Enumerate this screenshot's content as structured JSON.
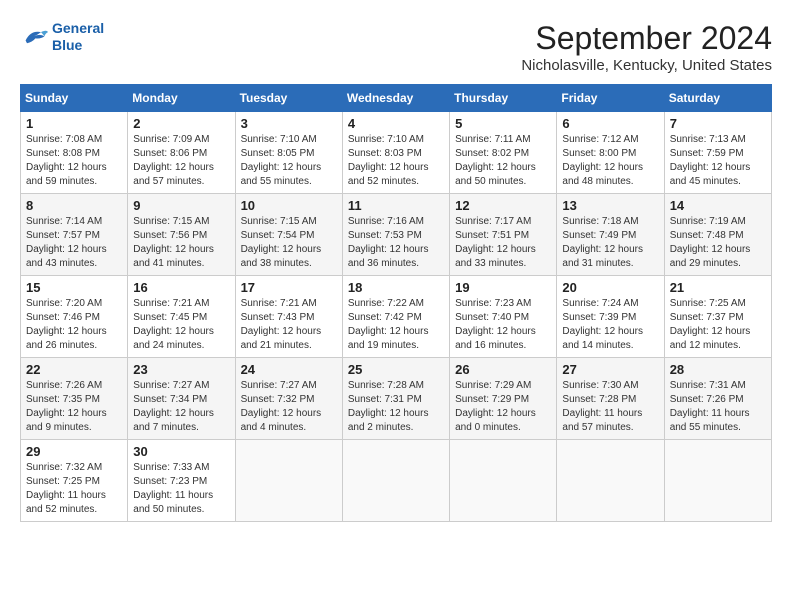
{
  "header": {
    "logo_line1": "General",
    "logo_line2": "Blue",
    "month_year": "September 2024",
    "location": "Nicholasville, Kentucky, United States"
  },
  "calendar": {
    "weekdays": [
      "Sunday",
      "Monday",
      "Tuesday",
      "Wednesday",
      "Thursday",
      "Friday",
      "Saturday"
    ],
    "weeks": [
      [
        {
          "day": "",
          "info": ""
        },
        {
          "day": "2",
          "info": "Sunrise: 7:09 AM\nSunset: 8:06 PM\nDaylight: 12 hours\nand 57 minutes."
        },
        {
          "day": "3",
          "info": "Sunrise: 7:10 AM\nSunset: 8:05 PM\nDaylight: 12 hours\nand 55 minutes."
        },
        {
          "day": "4",
          "info": "Sunrise: 7:10 AM\nSunset: 8:03 PM\nDaylight: 12 hours\nand 52 minutes."
        },
        {
          "day": "5",
          "info": "Sunrise: 7:11 AM\nSunset: 8:02 PM\nDaylight: 12 hours\nand 50 minutes."
        },
        {
          "day": "6",
          "info": "Sunrise: 7:12 AM\nSunset: 8:00 PM\nDaylight: 12 hours\nand 48 minutes."
        },
        {
          "day": "7",
          "info": "Sunrise: 7:13 AM\nSunset: 7:59 PM\nDaylight: 12 hours\nand 45 minutes."
        }
      ],
      [
        {
          "day": "8",
          "info": "Sunrise: 7:14 AM\nSunset: 7:57 PM\nDaylight: 12 hours\nand 43 minutes."
        },
        {
          "day": "9",
          "info": "Sunrise: 7:15 AM\nSunset: 7:56 PM\nDaylight: 12 hours\nand 41 minutes."
        },
        {
          "day": "10",
          "info": "Sunrise: 7:15 AM\nSunset: 7:54 PM\nDaylight: 12 hours\nand 38 minutes."
        },
        {
          "day": "11",
          "info": "Sunrise: 7:16 AM\nSunset: 7:53 PM\nDaylight: 12 hours\nand 36 minutes."
        },
        {
          "day": "12",
          "info": "Sunrise: 7:17 AM\nSunset: 7:51 PM\nDaylight: 12 hours\nand 33 minutes."
        },
        {
          "day": "13",
          "info": "Sunrise: 7:18 AM\nSunset: 7:49 PM\nDaylight: 12 hours\nand 31 minutes."
        },
        {
          "day": "14",
          "info": "Sunrise: 7:19 AM\nSunset: 7:48 PM\nDaylight: 12 hours\nand 29 minutes."
        }
      ],
      [
        {
          "day": "15",
          "info": "Sunrise: 7:20 AM\nSunset: 7:46 PM\nDaylight: 12 hours\nand 26 minutes."
        },
        {
          "day": "16",
          "info": "Sunrise: 7:21 AM\nSunset: 7:45 PM\nDaylight: 12 hours\nand 24 minutes."
        },
        {
          "day": "17",
          "info": "Sunrise: 7:21 AM\nSunset: 7:43 PM\nDaylight: 12 hours\nand 21 minutes."
        },
        {
          "day": "18",
          "info": "Sunrise: 7:22 AM\nSunset: 7:42 PM\nDaylight: 12 hours\nand 19 minutes."
        },
        {
          "day": "19",
          "info": "Sunrise: 7:23 AM\nSunset: 7:40 PM\nDaylight: 12 hours\nand 16 minutes."
        },
        {
          "day": "20",
          "info": "Sunrise: 7:24 AM\nSunset: 7:39 PM\nDaylight: 12 hours\nand 14 minutes."
        },
        {
          "day": "21",
          "info": "Sunrise: 7:25 AM\nSunset: 7:37 PM\nDaylight: 12 hours\nand 12 minutes."
        }
      ],
      [
        {
          "day": "22",
          "info": "Sunrise: 7:26 AM\nSunset: 7:35 PM\nDaylight: 12 hours\nand 9 minutes."
        },
        {
          "day": "23",
          "info": "Sunrise: 7:27 AM\nSunset: 7:34 PM\nDaylight: 12 hours\nand 7 minutes."
        },
        {
          "day": "24",
          "info": "Sunrise: 7:27 AM\nSunset: 7:32 PM\nDaylight: 12 hours\nand 4 minutes."
        },
        {
          "day": "25",
          "info": "Sunrise: 7:28 AM\nSunset: 7:31 PM\nDaylight: 12 hours\nand 2 minutes."
        },
        {
          "day": "26",
          "info": "Sunrise: 7:29 AM\nSunset: 7:29 PM\nDaylight: 12 hours\nand 0 minutes."
        },
        {
          "day": "27",
          "info": "Sunrise: 7:30 AM\nSunset: 7:28 PM\nDaylight: 11 hours\nand 57 minutes."
        },
        {
          "day": "28",
          "info": "Sunrise: 7:31 AM\nSunset: 7:26 PM\nDaylight: 11 hours\nand 55 minutes."
        }
      ],
      [
        {
          "day": "29",
          "info": "Sunrise: 7:32 AM\nSunset: 7:25 PM\nDaylight: 11 hours\nand 52 minutes."
        },
        {
          "day": "30",
          "info": "Sunrise: 7:33 AM\nSunset: 7:23 PM\nDaylight: 11 hours\nand 50 minutes."
        },
        {
          "day": "",
          "info": ""
        },
        {
          "day": "",
          "info": ""
        },
        {
          "day": "",
          "info": ""
        },
        {
          "day": "",
          "info": ""
        },
        {
          "day": "",
          "info": ""
        }
      ]
    ],
    "week1_day1": {
      "day": "1",
      "info": "Sunrise: 7:08 AM\nSunset: 8:08 PM\nDaylight: 12 hours\nand 59 minutes."
    }
  }
}
